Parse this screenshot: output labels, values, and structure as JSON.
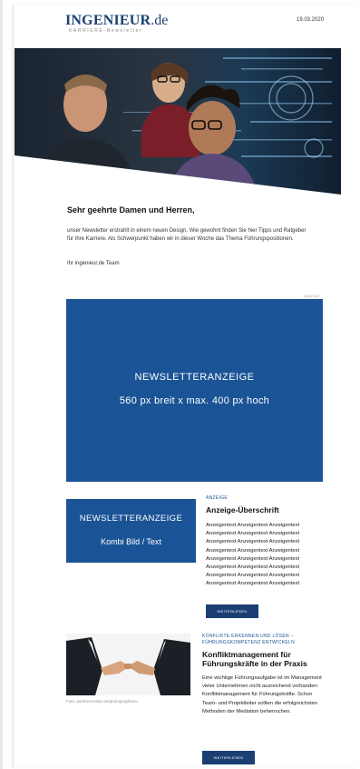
{
  "header": {
    "logo_main": "INGENIEUR",
    "logo_domain": ".de",
    "logo_sub": "KARRIERE-Newsletter",
    "date": "19.03.2020"
  },
  "intro": {
    "greeting": "Sehr geehrte Damen und Herren,",
    "text": "unser Newsletter erstrahlt in einem neuen Design. Wie gewohnt finden Sie hier Tipps und Ratgeber für Ihre Karriere. Als Schwerpunkt haben wir in dieser Woche das Thema Führungspositionen.",
    "signoff": "Ihr ingenieur.de Team"
  },
  "big_ad": {
    "small_label": "ANZEIGE",
    "line1": "NEWSLETTERANZEIGE",
    "line2": "560 px breit x max. 400 px hoch"
  },
  "combo_ad": {
    "line1": "NEWSLETTERANZEIGE",
    "line2": "Kombi Bild / Text"
  },
  "ad_article": {
    "eyebrow": "ANZEIGE",
    "title": "Anzeige-Überschrift",
    "lines": [
      "Anzeigentext Anzeigentext Anzeigentext",
      "Anzeigentext Anzeigentext Anzeigentext",
      "Anzeigentext Anzeigentext Anzeigentext",
      "Anzeigentext Anzeigentext Anzeigentext",
      "Anzeigentext Anzeigentext Anzeigentext",
      "Anzeigentext Anzeigentext Anzeigentext",
      "Anzeigentext Anzeigentext Anzeigentext",
      "Anzeigentext Anzeigentext Anzeigentext"
    ],
    "button": "WEITERLESEN"
  },
  "article2": {
    "eyebrow": "KONFLIKTE ERKENNEN UND LÖSEN – FÜHRUNGSKOMPETENZ ENTWICKELN",
    "title": "Konfliktmanagement für Führungskräfte in der Praxis",
    "body": "Eine wichtige Führungsaufgabe ist im Management vieler Unternehmen nicht ausreichend vorhanden: Konfliktmanagement für Führungskräfte. Schon Team- und Projektleiter sollten die erfolgreichsten Methoden der Mediation beherrschen.",
    "photo_credit": "Foto: panthermedia.net/photographieeu",
    "button": "WEITERLESEN"
  },
  "colors": {
    "brand_dark": "#1b3f73",
    "ad_blue": "#1b5496"
  }
}
